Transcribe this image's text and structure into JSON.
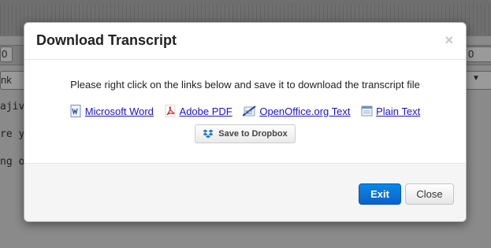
{
  "background": {
    "left_fragments": [
      "ajiv",
      "re y",
      "ng o"
    ],
    "bar_glyphs": [
      "0",
      "0",
      "nk"
    ]
  },
  "dialog": {
    "title": "Download Transcript",
    "close_glyph": "×",
    "instruction": "Please right click on the links below and save it to download the transcript file",
    "links": [
      {
        "label": "Microsoft Word",
        "icon": "word-doc-icon"
      },
      {
        "label": "Adobe PDF",
        "icon": "pdf-icon"
      },
      {
        "label": "OpenOffice.org Text",
        "icon": "openoffice-icon"
      },
      {
        "label": "Plain Text",
        "icon": "text-file-icon"
      }
    ],
    "dropbox_label": "Save to Dropbox",
    "exit_label": "Exit",
    "close_label": "Close"
  },
  "colors": {
    "link": "#1b14c9",
    "primary_button": "#0a74d8",
    "dropbox_blue": "#1f78d1"
  }
}
